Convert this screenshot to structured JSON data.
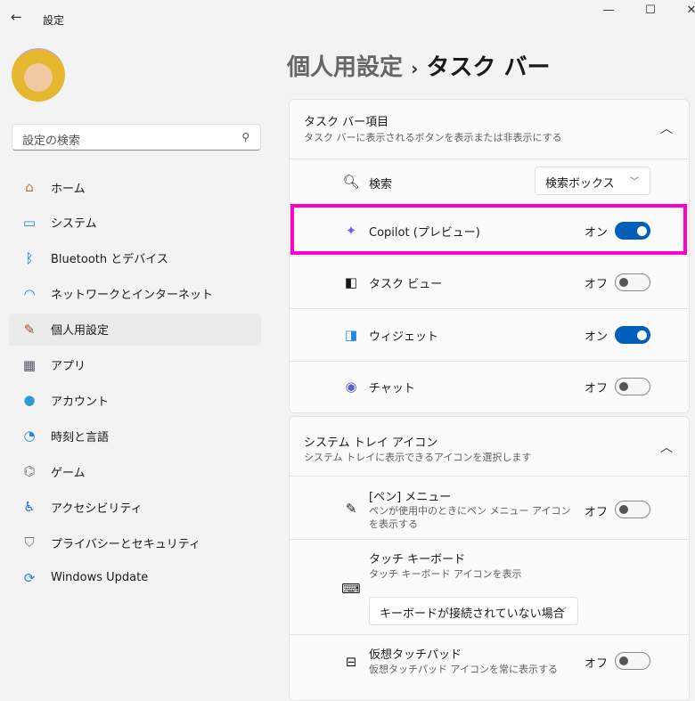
{
  "window": {
    "title": "設定",
    "back": "←",
    "minimize": "—",
    "maximize": "☐",
    "close": "✕"
  },
  "sidebar": {
    "search_placeholder": "設定の検索",
    "items": [
      {
        "label": "ホーム",
        "icon": "home-icon"
      },
      {
        "label": "システム",
        "icon": "system-icon"
      },
      {
        "label": "Bluetooth とデバイス",
        "icon": "bluetooth-icon"
      },
      {
        "label": "ネットワークとインターネット",
        "icon": "wifi-icon"
      },
      {
        "label": "個人用設定",
        "icon": "brush-icon",
        "active": true
      },
      {
        "label": "アプリ",
        "icon": "apps-icon"
      },
      {
        "label": "アカウント",
        "icon": "account-icon"
      },
      {
        "label": "時刻と言語",
        "icon": "time-language-icon"
      },
      {
        "label": "ゲーム",
        "icon": "gamepad-icon"
      },
      {
        "label": "アクセシビリティ",
        "icon": "accessibility-icon"
      },
      {
        "label": "プライバシーとセキュリティ",
        "icon": "shield-icon"
      },
      {
        "label": "Windows Update",
        "icon": "update-icon"
      }
    ]
  },
  "header": {
    "parent": "個人用設定",
    "sep": "›",
    "title": "タスク バー"
  },
  "taskbar_items": {
    "title": "タスク バー項目",
    "subtitle": "タスク バーに表示されるボタンを表示または非表示にする",
    "search": {
      "label": "検索",
      "value": "検索ボックス"
    },
    "rows": [
      {
        "label": "Copilot (プレビュー)",
        "state": "オン",
        "on": true
      },
      {
        "label": "タスク ビュー",
        "state": "オフ",
        "on": false
      },
      {
        "label": "ウィジェット",
        "state": "オン",
        "on": true
      },
      {
        "label": "チャット",
        "state": "オフ",
        "on": false
      }
    ]
  },
  "tray": {
    "title": "システム トレイ アイコン",
    "subtitle": "システム トレイに表示できるアイコンを選択します",
    "pen": {
      "label": "[ペン] メニュー",
      "desc": "ペンが使用中のときにペン メニュー アイコンを表示する",
      "state": "オフ"
    },
    "keyboard": {
      "label": "タッチ キーボード",
      "desc": "タッチ キーボード アイコンを表示",
      "value": "キーボードが接続されていない場合"
    },
    "touchpad": {
      "label": "仮想タッチパッド",
      "desc": "仮想タッチパッド アイコンを常に表示する",
      "state": "オフ"
    }
  },
  "colors": {
    "accent": "#005fb8",
    "highlight": "#ff00c8"
  }
}
